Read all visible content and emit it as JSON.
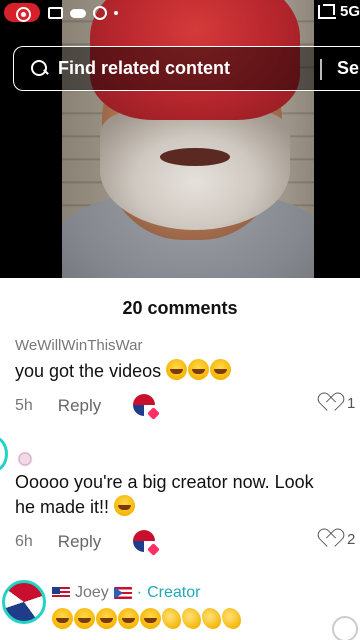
{
  "status_bar": {
    "network": "5G"
  },
  "search": {
    "query": "Find related content",
    "button_label": "Se"
  },
  "comments_sheet": {
    "title": "20 comments",
    "comments": [
      {
        "username": "WeWillWinThisWar",
        "text": "you got the videos",
        "age": "5h",
        "reply_label": "Reply",
        "likes": "1"
      },
      {
        "username": "",
        "text_line1": "Ooooo you're a big creator now. Look",
        "text_line2": "he made it!!",
        "age": "6h",
        "reply_label": "Reply",
        "likes": "2"
      },
      {
        "username": "Joey",
        "role": "Creator",
        "separator": "·"
      }
    ]
  },
  "colors": {
    "accent_teal": "#22d3c5",
    "creator_label": "#20a9b8",
    "record_red": "#d6212b"
  }
}
